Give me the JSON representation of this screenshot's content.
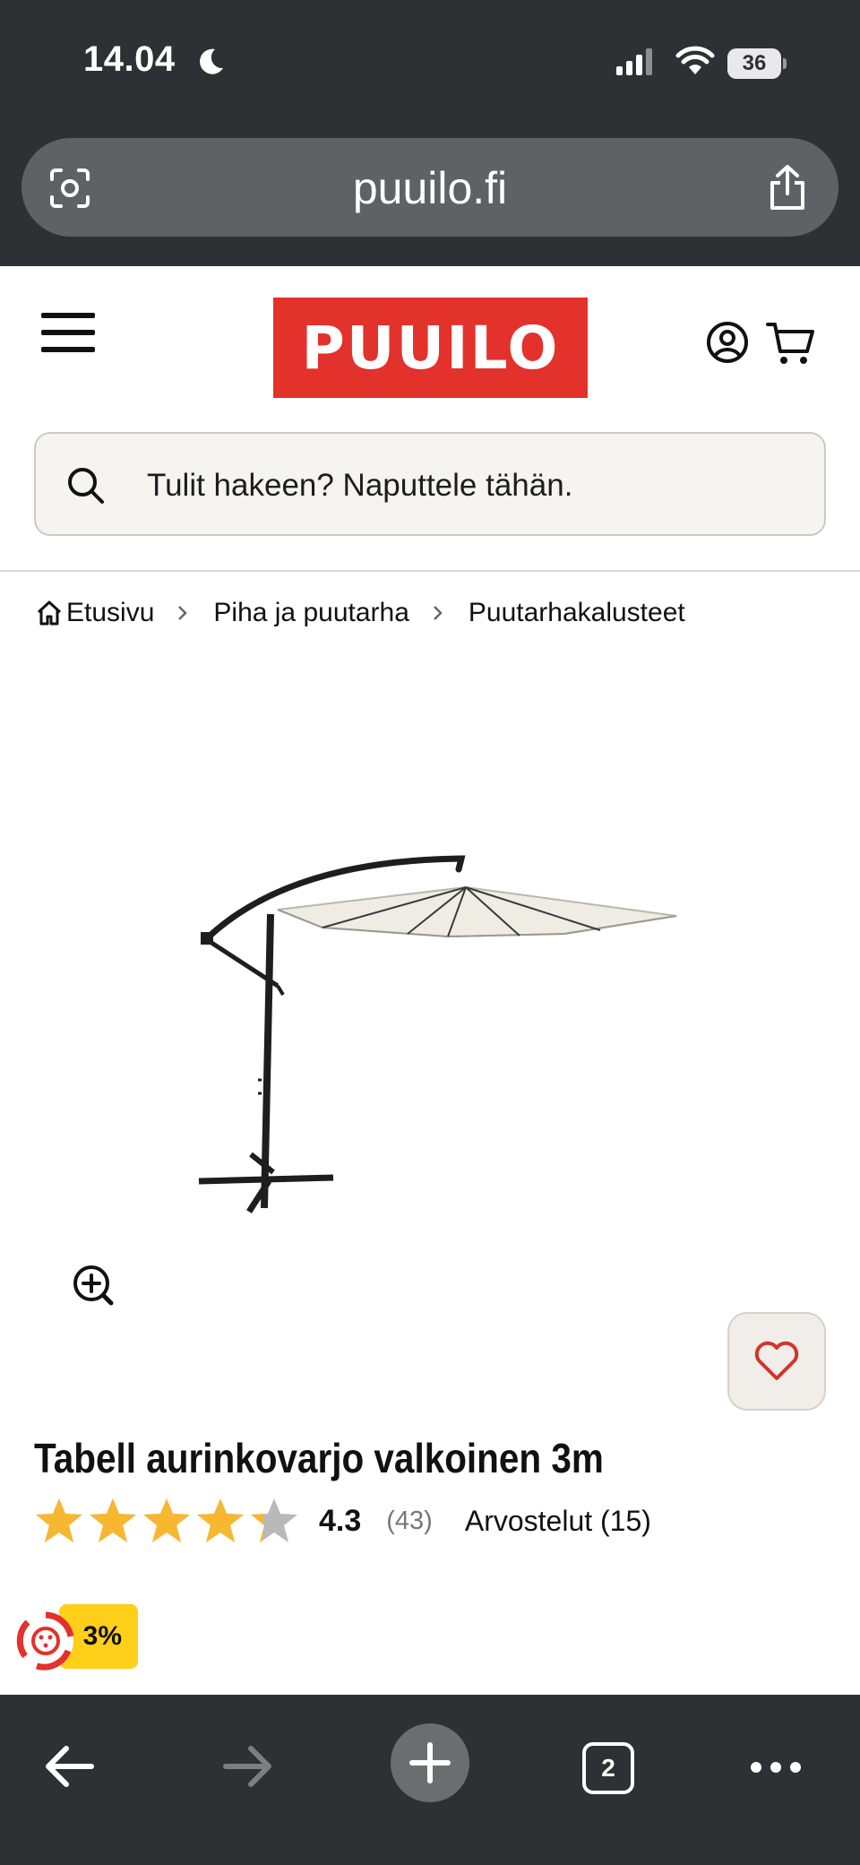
{
  "status_bar": {
    "time": "14.04",
    "battery": "36"
  },
  "browser": {
    "url": "puuilo.fi",
    "open_tabs": "2"
  },
  "header": {
    "logo_text": "PUUILO",
    "brand_color": "#e3312c"
  },
  "search": {
    "placeholder": "Tulit hakeen? Naputtele tähän."
  },
  "breadcrumb": {
    "items": [
      "Etusivu",
      "Piha ja puutarha",
      "Puutarhakalusteet"
    ]
  },
  "product": {
    "title": "Tabell aurinkovarjo valkoinen 3m",
    "rating": "4.3",
    "rating_fraction": 0.86,
    "rating_count": "(43)",
    "reviews_label": "Arvostelut (15)",
    "discount_badge": "3%",
    "star_color": "#f7b731"
  },
  "icons": [
    "moon-icon",
    "signal-icon",
    "wifi-icon",
    "page-settings-icon",
    "share-icon",
    "hamburger-icon",
    "account-icon",
    "cart-icon",
    "search-icon",
    "home-icon",
    "chevron-right-icon",
    "zoom-in-icon",
    "heart-icon",
    "promo-icon",
    "back-icon",
    "forward-icon",
    "plus-icon",
    "more-icon"
  ]
}
